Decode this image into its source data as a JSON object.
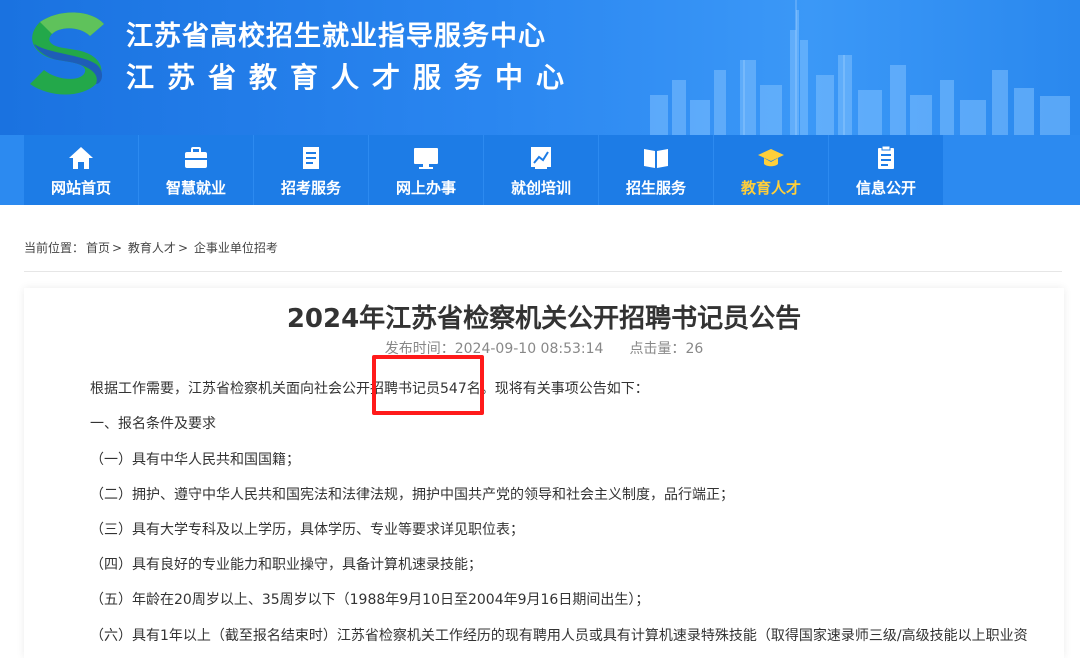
{
  "header": {
    "title_line1": "江苏省高校招生就业指导服务中心",
    "title_line2": "江苏省教育人才服务中心"
  },
  "nav": {
    "items": [
      {
        "label": "网站首页",
        "icon": "home-icon"
      },
      {
        "label": "智慧就业",
        "icon": "briefcase-icon"
      },
      {
        "label": "招考服务",
        "icon": "document-icon"
      },
      {
        "label": "网上办事",
        "icon": "monitor-icon"
      },
      {
        "label": "就创培训",
        "icon": "chart-icon"
      },
      {
        "label": "招生服务",
        "icon": "book-icon"
      },
      {
        "label": "教育人才",
        "icon": "graduation-cap-icon",
        "active": true
      },
      {
        "label": "信息公开",
        "icon": "clipboard-icon"
      }
    ]
  },
  "breadcrumb": {
    "prefix": "当前位置：",
    "items": [
      "首页",
      "教育人才",
      "企事业单位招考"
    ],
    "separator": ">"
  },
  "article": {
    "title": "2024年江苏省检察机关公开招聘书记员公告",
    "publish_label": "发布时间：",
    "publish_time": "2024-09-10 08:53:14",
    "clicks_label": "点击量：",
    "clicks": "26",
    "paragraphs": [
      "根据工作需要，江苏省检察机关面向社会公开招聘书记员547名。现将有关事项公告如下：",
      "一、报名条件及要求",
      "（一）具有中华人民共和国国籍；",
      "（二）拥护、遵守中华人民共和国宪法和法律法规，拥护中国共产党的领导和社会主义制度，品行端正；",
      "（三）具有大学专科及以上学历，具体学历、专业等要求详见职位表；",
      "（四）具有良好的专业能力和职业操守，具备计算机速录技能；",
      "（五）年龄在20周岁以上、35周岁以下（1988年9月10日至2004年9月16日期间出生）；",
      "（六）具有1年以上（截至报名结束时）江苏省检察机关工作经历的现有聘用人员或具有计算机速录特殊技能（取得国家速录师三级/高级技能以上职业资"
    ]
  },
  "colors": {
    "header_blue": "#1a72e0",
    "nav_blue": "#1d7ce6",
    "active_yellow": "#ffcf3a",
    "highlight_red": "#ff1a1a"
  }
}
